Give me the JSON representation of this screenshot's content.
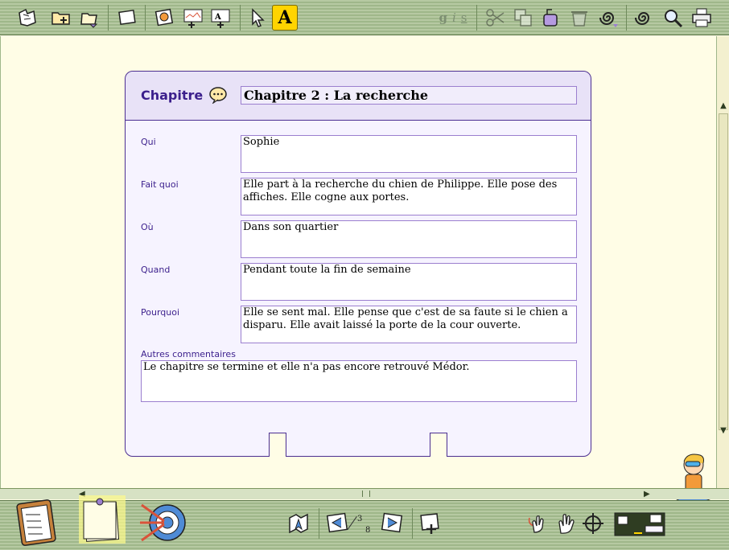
{
  "card": {
    "label": "Chapitre",
    "title": "Chapitre 2 : La recherche",
    "fields": [
      {
        "label": "Qui",
        "value": "Sophie"
      },
      {
        "label": "Fait quoi",
        "value": "Elle part à la recherche du chien de Philippe. Elle pose des affiches. Elle cogne aux portes."
      },
      {
        "label": "Où",
        "value": "Dans son quartier"
      },
      {
        "label": "Quand",
        "value": "Pendant toute la fin de semaine"
      },
      {
        "label": "Pourquoi",
        "value": "Elle se sent mal. Elle pense que c'est de sa faute si le chien a disparu. Elle avait laissé la porte de la cour ouverte."
      }
    ],
    "comments": {
      "label": "Autres commentaires",
      "value": "Le chapitre se termine et elle n'a pas encore retrouvé Médor."
    }
  },
  "toolbar": {
    "font_button": "A",
    "style_bold": "g",
    "style_italic": "i",
    "style_underline": "s"
  },
  "pager": {
    "current": "3",
    "total": "8"
  },
  "colors": {
    "accent": "#3b1f8c",
    "toolbar": "#b6c9a2",
    "highlight": "#ffd400",
    "card_bg": "#f6f3ff"
  }
}
